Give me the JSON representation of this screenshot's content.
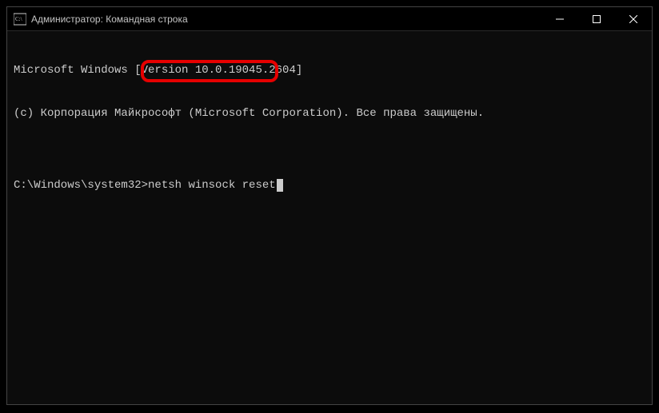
{
  "titlebar": {
    "title": "Администратор: Командная строка",
    "minimize": "—",
    "maximize": "□",
    "close": "✕"
  },
  "terminal": {
    "line1": "Microsoft Windows [Version 10.0.19045.2604]",
    "line2": "(c) Корпорация Майкрософт (Microsoft Corporation). Все права защищены.",
    "blank": "",
    "prompt": "C:\\Windows\\system32>",
    "command": "netsh winsock reset"
  }
}
